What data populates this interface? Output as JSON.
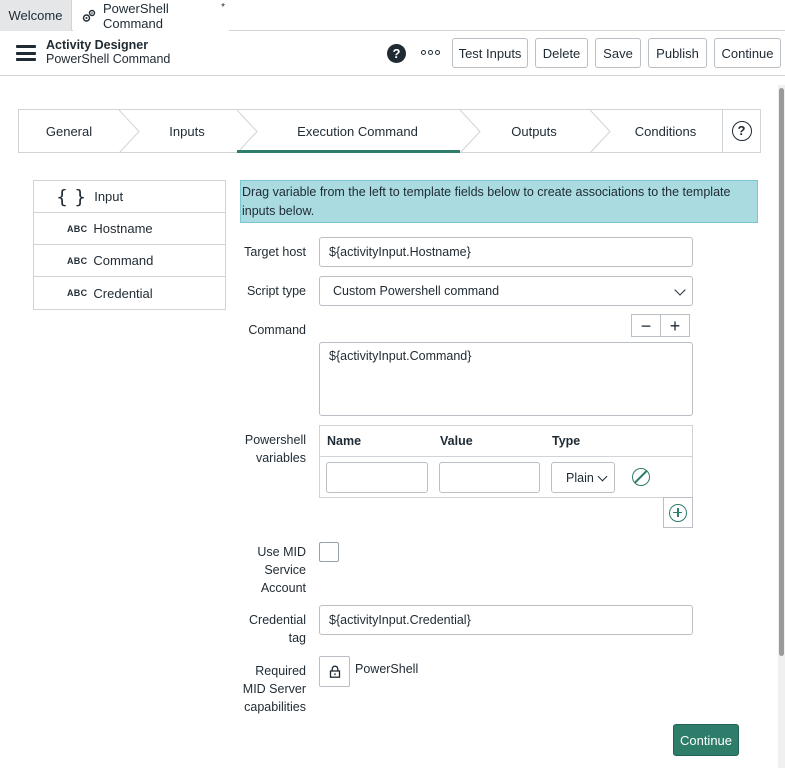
{
  "tabs": {
    "welcome": "Welcome",
    "active": "PowerShell Command",
    "modified_marker": "*"
  },
  "header": {
    "title": "Activity Designer",
    "subtitle": "PowerShell Command",
    "buttons": {
      "test_inputs": "Test Inputs",
      "delete": "Delete",
      "save": "Save",
      "publish": "Publish",
      "continue": "Continue"
    },
    "help_glyph": "?",
    "more_icon": "more-horizontal-icon"
  },
  "steps": {
    "items": [
      "General",
      "Inputs",
      "Execution Command",
      "Outputs",
      "Conditions"
    ],
    "active_index": 2,
    "help_glyph": "?"
  },
  "inputs": {
    "header_label": "Input",
    "header_glyph": "{ }",
    "type_label": "ABC",
    "items": [
      "Hostname",
      "Command",
      "Credential"
    ]
  },
  "banner": {
    "text": "Drag variable from the left to template fields below to create associations to the template inputs below."
  },
  "form": {
    "target_host": {
      "label": "Target host",
      "value": "${activityInput.Hostname}"
    },
    "script_type": {
      "label": "Script type",
      "value": "Custom Powershell command"
    },
    "command": {
      "label": "Command",
      "value": "${activityInput.Command}",
      "minus": "−",
      "plus": "+"
    },
    "ps_variables": {
      "label_line1": "Powershell",
      "label_line2": "variables",
      "col_name": "Name",
      "col_value": "Value",
      "col_type": "Type",
      "row_type_value": "Plain"
    },
    "use_mid": {
      "line1": "Use MID",
      "line2": "Service",
      "line3": "Account",
      "checked": false
    },
    "credential_tag": {
      "line1": "Credential",
      "line2": "tag",
      "value": "${activityInput.Credential}"
    },
    "capabilities": {
      "line1": "Required",
      "line2": "MID Server",
      "line3": "capabilities",
      "value": "PowerShell"
    },
    "continue_label": "Continue"
  },
  "colors": {
    "accent": "#2e7d6b",
    "banner_bg": "#a9dbe1",
    "border": "#cfd4d8",
    "text": "#1f2a33"
  }
}
